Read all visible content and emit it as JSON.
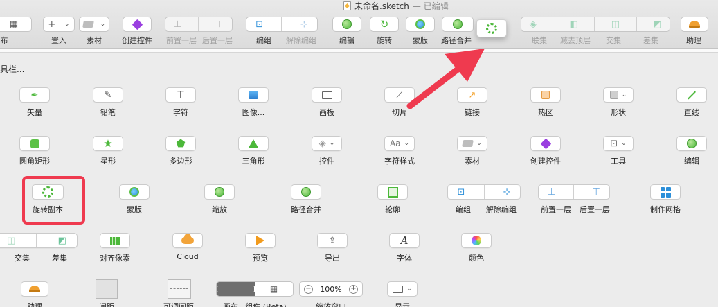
{
  "window": {
    "title": "未命名.sketch",
    "title_suffix": "— 已编辑"
  },
  "toolbar": {
    "items": [
      {
        "label": "布",
        "icon": "grid-icon"
      },
      {
        "label": "置入",
        "icon": "plus-icon"
      },
      {
        "label": "素材",
        "icon": "layers-icon"
      },
      {
        "label": "创建控件",
        "icon": "diamond-icon"
      },
      {
        "label": "前置一层",
        "icon": "bring-forward-icon"
      },
      {
        "label": "后置一层",
        "icon": "send-backward-icon"
      },
      {
        "label": "编组",
        "icon": "group-icon"
      },
      {
        "label": "解除编组",
        "icon": "ungroup-icon"
      },
      {
        "label": "编辑",
        "icon": "edit-icon"
      },
      {
        "label": "旋转",
        "icon": "rotate-icon"
      },
      {
        "label": "蒙版",
        "icon": "mask-icon"
      },
      {
        "label": "路径合并",
        "icon": "flatten-icon"
      },
      {
        "label": "联集",
        "icon": "union-icon"
      },
      {
        "label": "减去顶层",
        "icon": "subtract-icon"
      },
      {
        "label": "交集",
        "icon": "intersect-icon"
      },
      {
        "label": "差集",
        "icon": "difference-icon"
      },
      {
        "label": "助理",
        "icon": "bell-icon"
      }
    ]
  },
  "heading": "具栏...",
  "palette": {
    "row1": [
      "矢量",
      "铅笔",
      "字符",
      "图像...",
      "画板",
      "切片",
      "链接",
      "热区",
      "形状",
      "直线"
    ],
    "row2": [
      "圆角矩形",
      "星形",
      "多边形",
      "三角形",
      "控件",
      "字符样式",
      "素材",
      "创建控件",
      "工具",
      "编辑"
    ],
    "row3": [
      "旋转副本",
      "蒙版",
      "缩放",
      "路径合并",
      "轮廓",
      "编组",
      "解除编组",
      "前置一层",
      "后置一层",
      "制作网格"
    ],
    "row4": [
      "交集",
      "差集",
      "对齐像素",
      "Cloud",
      "预览",
      "导出",
      "字体",
      "颜色"
    ],
    "row5": [
      "助理",
      "间距",
      "可调间距",
      "画布",
      "组件 (Beta)",
      "缩放窗口",
      "显示"
    ],
    "glyph_text": "T",
    "aa_text": "Aa",
    "a_text": "A",
    "zoom_value": "100%",
    "zoom_minus": "−",
    "zoom_plus": "+"
  },
  "colors": {
    "highlight": "#ef3a4f",
    "accent_green": "#4cb83a"
  }
}
